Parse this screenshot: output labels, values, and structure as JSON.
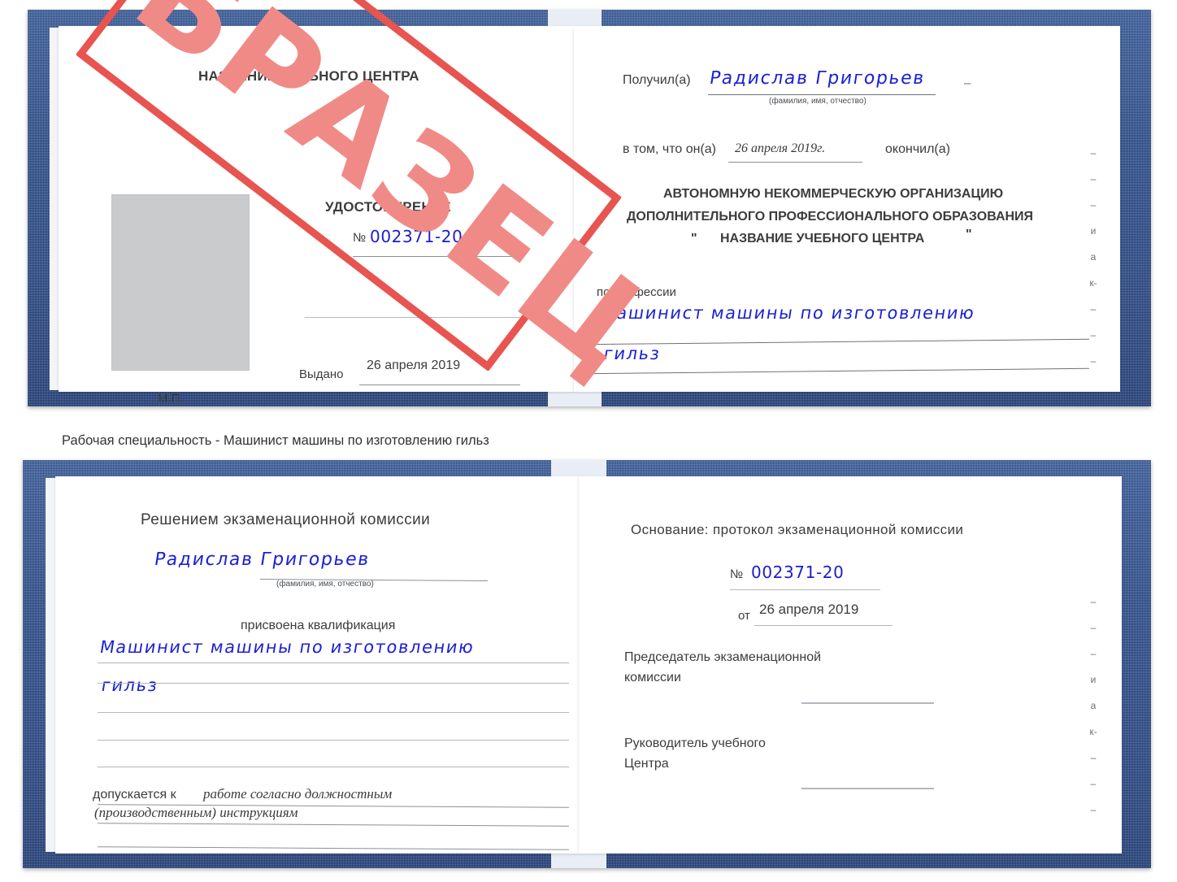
{
  "document": {
    "type": "certificate-scan",
    "caption": "Рабочая специальность - Машинист машины по изготовлению гильз",
    "stamp": {
      "label": "ОБРАЗЕЦ",
      "color": "#e8544f"
    },
    "cover_color": "#2d5496",
    "ink_color": "#1c21d6"
  },
  "cert_top": {
    "left_page": {
      "org_title": "НАЗВАНИЕ УЧЕБНОГО ЦЕНТРА",
      "doc_title": "УДОСТОВЕРЕНИЕ",
      "number_label": "№",
      "number_value": "002371-20",
      "issued_label": "Выдано",
      "issued_value": "26 апреля 2019",
      "seal_label": "М.П."
    },
    "right_page": {
      "received_label": "Получил(а)",
      "received_value": "Радислав Григорьев",
      "name_hint": "(фамилия, имя, отчество)",
      "that_he_label": "в том, что он(а)",
      "completion_date": "26 апреля 2019г.",
      "graduated_label": "окончил(а)",
      "org_line1": "АВТОНОМНУЮ НЕКОММЕРЧЕСКУЮ ОРГАНИЗАЦИЮ",
      "org_line2": "ДОПОЛНИТЕЛЬНОГО ПРОФЕССИОНАЛЬНОГО ОБРАЗОВАНИЯ",
      "org_quote_open": "\"",
      "org_line3": "НАЗВАНИЕ УЧЕБНОГО ЦЕНТРА",
      "org_quote_close": "\"",
      "profession_label": "по профессии",
      "profession_value_line1": "Машинист машины по изготовлению",
      "profession_value_line2": "гильз",
      "edge_glyphs": [
        "–",
        "–",
        "–",
        "и",
        "а",
        "к-",
        "–",
        "–",
        "–"
      ]
    }
  },
  "cert_bottom": {
    "left_page": {
      "commission_title": "Решением экзаменационной комиссии",
      "name_value": "Радислав Григорьев",
      "name_hint": "(фамилия, имя, отчество)",
      "qualification_label": "присвоена квалификация",
      "qualification_line1": "Машинист машины по изготовлению",
      "qualification_line2": "гильз",
      "admitted_label": "допускается к",
      "admitted_value_line1": "работе согласно должностным",
      "admitted_value_line2": "(производственным) инструкциям"
    },
    "right_page": {
      "basis_label": "Основание: протокол экзаменационной комиссии",
      "number_label": "№",
      "number_value": "002371-20",
      "date_label": "от",
      "date_value": "26 апреля 2019",
      "chairman_line1": "Председатель экзаменационной",
      "chairman_line2": "комиссии",
      "head_line1": "Руководитель учебного",
      "head_line2": "Центра",
      "edge_glyphs": [
        "–",
        "–",
        "–",
        "и",
        "а",
        "к-",
        "–",
        "–",
        "–"
      ]
    }
  }
}
